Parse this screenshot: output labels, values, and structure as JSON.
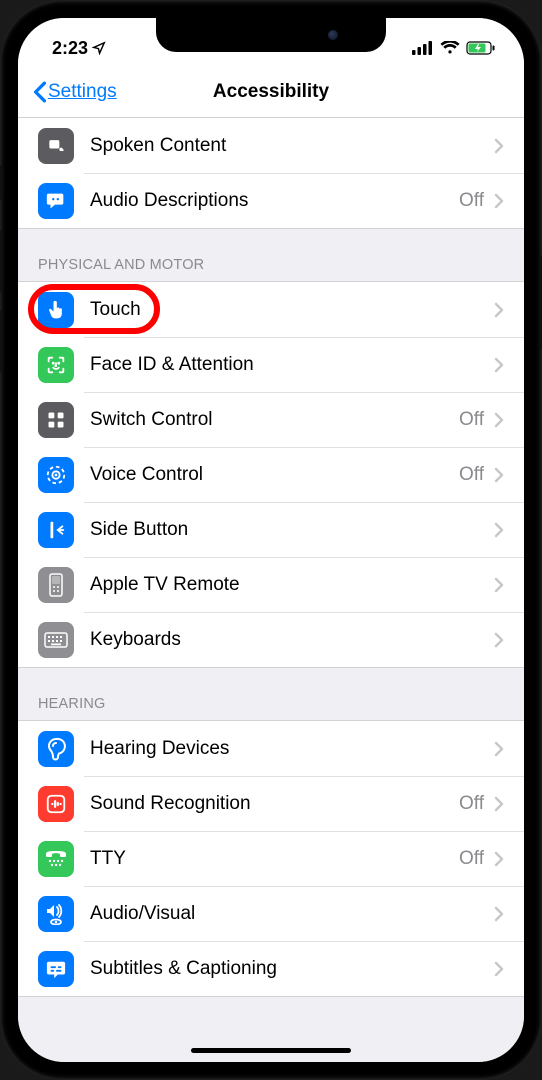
{
  "status": {
    "time": "2:23"
  },
  "nav": {
    "back": "Settings",
    "title": "Accessibility"
  },
  "off_label": "Off",
  "sections": [
    {
      "header": null,
      "rows": [
        {
          "icon": "speaker-icon",
          "color": "darkgray",
          "label": "Spoken Content",
          "value": null
        },
        {
          "icon": "descriptions-icon",
          "color": "blue",
          "label": "Audio Descriptions",
          "value": "Off"
        }
      ]
    },
    {
      "header": "PHYSICAL AND MOTOR",
      "rows": [
        {
          "icon": "touch-icon",
          "color": "blue",
          "label": "Touch",
          "value": null,
          "highlight": true
        },
        {
          "icon": "faceid-icon",
          "color": "green",
          "label": "Face ID & Attention",
          "value": null
        },
        {
          "icon": "switch-icon",
          "color": "darkgray",
          "label": "Switch Control",
          "value": "Off"
        },
        {
          "icon": "voice-icon",
          "color": "blue",
          "label": "Voice Control",
          "value": "Off"
        },
        {
          "icon": "sidebutton-icon",
          "color": "blue",
          "label": "Side Button",
          "value": null
        },
        {
          "icon": "appletv-icon",
          "color": "gray",
          "label": "Apple TV Remote",
          "value": null
        },
        {
          "icon": "keyboard-icon",
          "color": "gray",
          "label": "Keyboards",
          "value": null
        }
      ]
    },
    {
      "header": "HEARING",
      "rows": [
        {
          "icon": "ear-icon",
          "color": "blue",
          "label": "Hearing Devices",
          "value": null
        },
        {
          "icon": "sound-icon",
          "color": "red",
          "label": "Sound Recognition",
          "value": "Off"
        },
        {
          "icon": "tty-icon",
          "color": "green",
          "label": "TTY",
          "value": "Off"
        },
        {
          "icon": "audiovis-icon",
          "color": "blue",
          "label": "Audio/Visual",
          "value": null
        },
        {
          "icon": "subtitles-icon",
          "color": "blue",
          "label": "Subtitles & Captioning",
          "value": null
        }
      ]
    }
  ]
}
